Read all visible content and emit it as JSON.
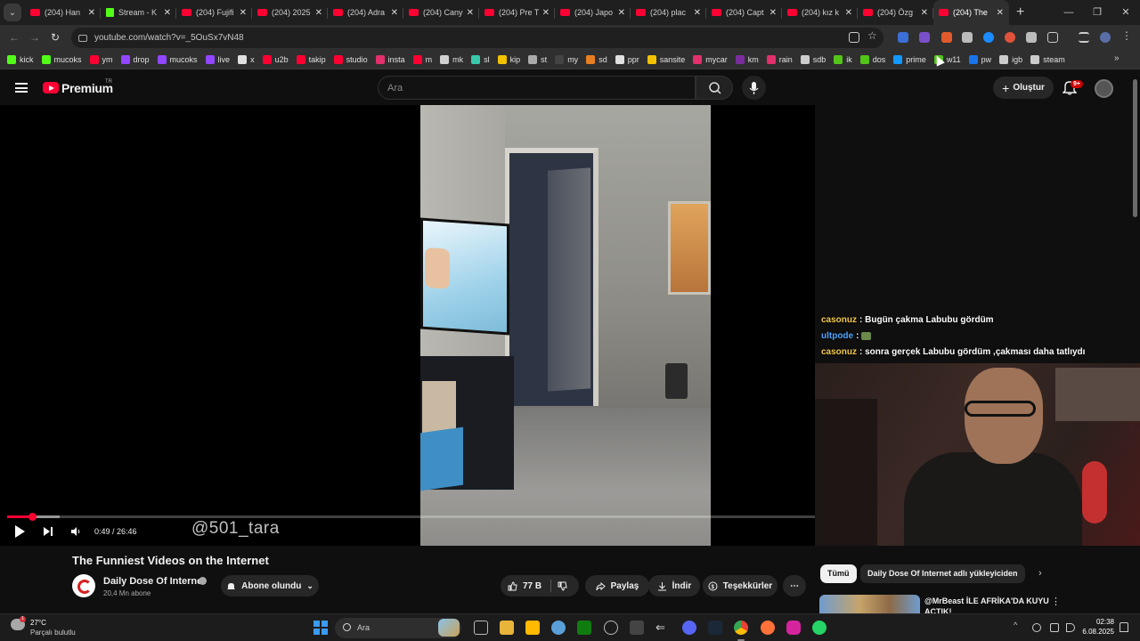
{
  "browser": {
    "tabs": [
      {
        "title": "(204) Han",
        "favicon": "youtube-icon"
      },
      {
        "title": "Stream - K",
        "favicon": "kick-icon"
      },
      {
        "title": "(204) Fujifi",
        "favicon": "youtube-icon"
      },
      {
        "title": "(204) 2025",
        "favicon": "youtube-icon"
      },
      {
        "title": "(204) Adra",
        "favicon": "youtube-icon"
      },
      {
        "title": "(204) Cany",
        "favicon": "youtube-icon"
      },
      {
        "title": "(204) Pre T",
        "favicon": "youtube-icon"
      },
      {
        "title": "(204) Japo",
        "favicon": "youtube-icon"
      },
      {
        "title": "(204) plac",
        "favicon": "youtube-icon"
      },
      {
        "title": "(204) Capt",
        "favicon": "youtube-icon"
      },
      {
        "title": "(204) kız k",
        "favicon": "youtube-icon"
      },
      {
        "title": "(204) Özg",
        "favicon": "youtube-icon"
      },
      {
        "title": "(204) The",
        "favicon": "youtube-icon",
        "active": true
      }
    ],
    "url": "youtube.com/watch?v=_5OuSx7vN48",
    "bookmarks": [
      {
        "label": "kick",
        "color": "#53fc18"
      },
      {
        "label": "mucoks",
        "color": "#53fc18"
      },
      {
        "label": "ym",
        "color": "#ff0033"
      },
      {
        "label": "drop",
        "color": "#9147ff"
      },
      {
        "label": "mucoks",
        "color": "#9147ff"
      },
      {
        "label": "live",
        "color": "#9147ff"
      },
      {
        "label": "x",
        "color": "#e0e0e0"
      },
      {
        "label": "u2b",
        "color": "#ff0033"
      },
      {
        "label": "takip",
        "color": "#ff0033"
      },
      {
        "label": "studio",
        "color": "#ff0033"
      },
      {
        "label": "insta",
        "color": "#e1306c"
      },
      {
        "label": "m",
        "color": "#ff0033"
      },
      {
        "label": "mk",
        "color": "#d0d0d0"
      },
      {
        "label": "sl",
        "color": "#3ac6a8"
      },
      {
        "label": "kip",
        "color": "#f2c200"
      },
      {
        "label": "st",
        "color": "#aaaaaa"
      },
      {
        "label": "my",
        "color": "#444444"
      },
      {
        "label": "sd",
        "color": "#e67e22"
      },
      {
        "label": "ppr",
        "color": "#e0e0e0"
      },
      {
        "label": "sansite",
        "color": "#f2c200"
      },
      {
        "label": "mycar",
        "color": "#e1306c"
      },
      {
        "label": "km",
        "color": "#7a2e9e"
      },
      {
        "label": "rain",
        "color": "#e1306c"
      },
      {
        "label": "sdb",
        "color": "#cccccc"
      },
      {
        "label": "ik",
        "color": "#53c41a"
      },
      {
        "label": "dos",
        "color": "#53c41a"
      },
      {
        "label": "prime",
        "color": "#1399ff"
      },
      {
        "label": "w11",
        "color": "#53c41a"
      },
      {
        "label": "pw",
        "color": "#1a73e8"
      },
      {
        "label": "igb",
        "color": "#cccccc"
      },
      {
        "label": "steam",
        "color": "#cccccc"
      }
    ]
  },
  "youtube": {
    "brand": "Premium",
    "country": "TR",
    "search_placeholder": "Ara",
    "create_label": "Oluştur",
    "notification_count": "9+"
  },
  "player": {
    "time": "0:49 / 26:46",
    "progress_played_fraction": 0.0305,
    "progress_loaded_fraction": 0.065,
    "watermark": "@501_tara"
  },
  "chat": [
    {
      "user": "casonuz",
      "user_color": "#f2c94c",
      "message": ": Bugün çakma Labubu gördüm",
      "emote": false
    },
    {
      "user": "ultpode",
      "user_color": "#4da3ff",
      "message": ":",
      "emote": true
    },
    {
      "user": "casonuz",
      "user_color": "#f2c94c",
      "message": ": sonra gerçek Labubu gördüm ,çakması daha tatlıydı",
      "emote": false
    }
  ],
  "video": {
    "title": "The Funniest Videos on the Internet",
    "channel": "Daily Dose Of Internet",
    "subscribers": "20,4 Mn abone",
    "subscribe_label": "Abone olundu",
    "likes": "77 B",
    "share_label": "Paylaş",
    "download_label": "İndir",
    "thanks_label": "Teşekkürler"
  },
  "sidebar": {
    "chip_all": "Tümü",
    "chip_uploads": "Daily Dose Of Internet adlı yükleyiciden",
    "rec_title": "@MrBeast İLE AFRİKA'DA KUYU AÇTIK!"
  },
  "taskbar": {
    "temperature": "27°C",
    "weather": "Parçalı bulutlu",
    "weather_badge": "1",
    "search_label": "Ara",
    "time": "02:38",
    "date": "6.08.2025"
  }
}
